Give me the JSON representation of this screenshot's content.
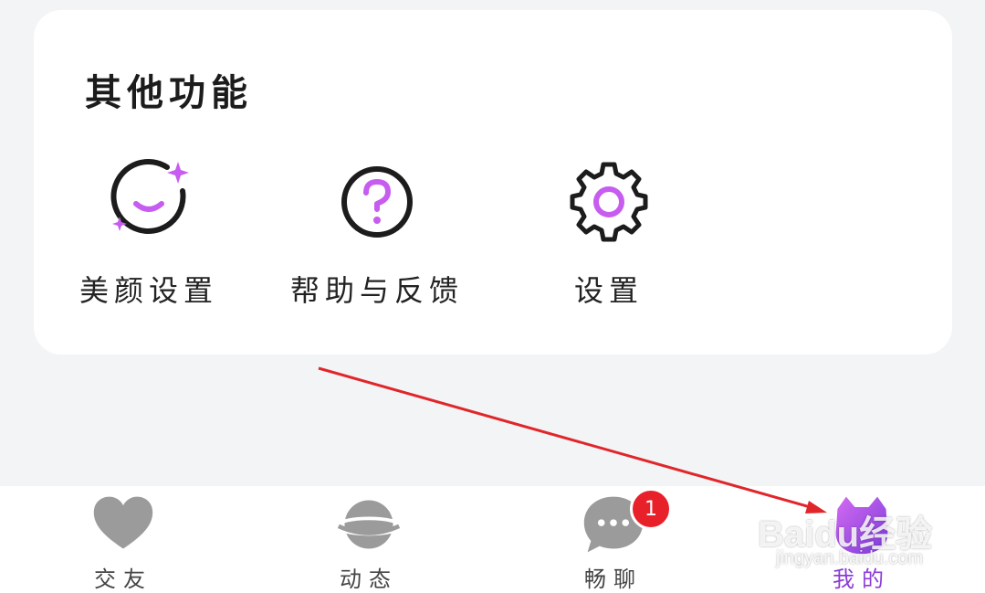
{
  "section": {
    "title": "其他功能",
    "features": [
      {
        "label": "美颜设置",
        "icon": "beauty-icon"
      },
      {
        "label": "帮助与反馈",
        "icon": "help-icon"
      },
      {
        "label": "设置",
        "icon": "gear-icon"
      }
    ]
  },
  "nav": {
    "items": [
      {
        "label": "交友",
        "icon": "heart-icon"
      },
      {
        "label": "动态",
        "icon": "planet-icon"
      },
      {
        "label": "畅聊",
        "icon": "chat-bubble-icon",
        "badge": "1"
      },
      {
        "label": "我的",
        "icon": "paw-profile-icon",
        "active": true
      }
    ]
  },
  "watermark": {
    "main": "Baidu经验",
    "sub": "jingyan.baidu.com"
  },
  "colors": {
    "accent": "#c65cf0",
    "active": "#8a3cd8",
    "badge": "#e8202a",
    "annotation_arrow": "#e0262a"
  }
}
